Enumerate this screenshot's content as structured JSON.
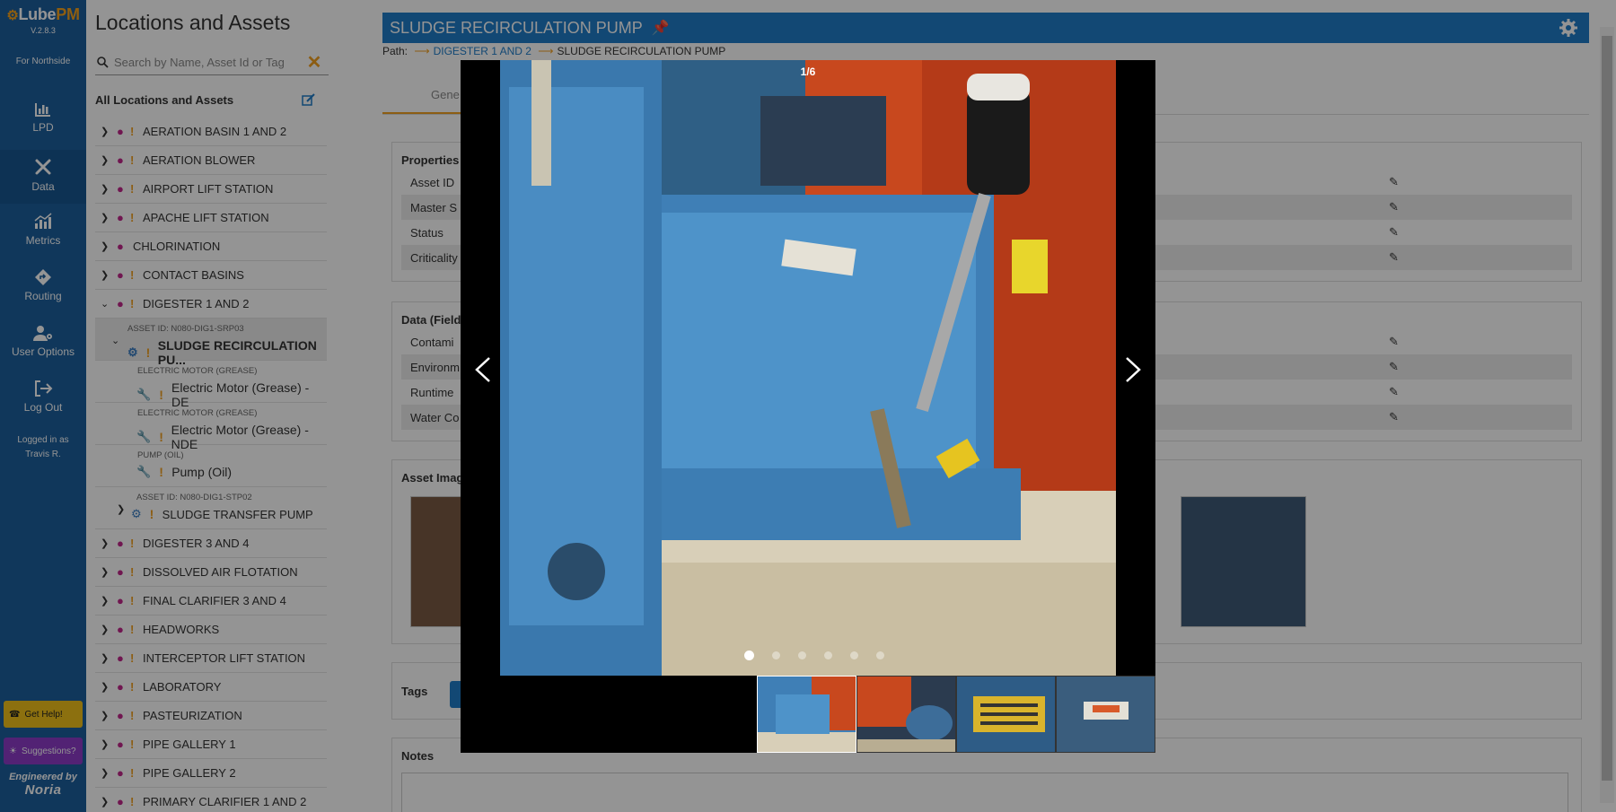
{
  "app": {
    "logo_prefix": "Lube",
    "logo_suffix": "PM",
    "version": "V.2.8.3",
    "org": "For Northside"
  },
  "nav": [
    {
      "label": "LPD",
      "icon": "bar-chart-icon"
    },
    {
      "label": "Data",
      "icon": "tools-icon"
    },
    {
      "label": "Metrics",
      "icon": "metrics-icon"
    },
    {
      "label": "Routing",
      "icon": "routing-icon"
    },
    {
      "label": "User Options",
      "icon": "user-gear-icon"
    },
    {
      "label": "Log Out",
      "icon": "logout-icon"
    }
  ],
  "user": {
    "logged_in_label": "Logged in as",
    "name": "Travis R."
  },
  "help": {
    "get_help": "Get Help!",
    "suggestions": "Suggestions?",
    "engineered_by": "Engineered by",
    "brand": "Noria"
  },
  "tree": {
    "title": "Locations and Assets",
    "search_placeholder": "Search by Name, Asset Id or Tag",
    "all_label": "All Locations and Assets",
    "rows_top": [
      {
        "label": "AERATION BASIN 1 AND 2",
        "flag": true
      },
      {
        "label": "AERATION BLOWER",
        "flag": true
      },
      {
        "label": "AIRPORT LIFT STATION",
        "flag": true
      },
      {
        "label": "APACHE LIFT STATION",
        "flag": true
      },
      {
        "label": "CHLORINATION",
        "flag": false
      },
      {
        "label": "CONTACT BASINS",
        "flag": true
      },
      {
        "label": "DIGESTER 1 AND 2",
        "flag": true
      }
    ],
    "children": [
      {
        "caption": "ASSET ID: N080-DIG1-SRP03",
        "label": "SLUDGE RECIRCULATION PU...",
        "kind": "asset",
        "selected": true
      },
      {
        "caption": "ELECTRIC MOTOR (GREASE)",
        "label": "Electric Motor (Grease) - DE",
        "kind": "component"
      },
      {
        "caption": "ELECTRIC MOTOR (GREASE)",
        "label": "Electric Motor (Grease) - NDE",
        "kind": "component"
      },
      {
        "caption": "PUMP (OIL)",
        "label": "Pump (Oil)",
        "kind": "component"
      },
      {
        "caption": "ASSET ID: N080-DIG1-STP02",
        "label": "SLUDGE TRANSFER PUMP",
        "kind": "asset2"
      }
    ],
    "rows_bottom": [
      {
        "label": "DIGESTER 3 AND 4"
      },
      {
        "label": "DISSOLVED AIR FLOTATION"
      },
      {
        "label": "FINAL CLARIFIER 3 AND 4"
      },
      {
        "label": "HEADWORKS"
      },
      {
        "label": "INTERCEPTOR LIFT STATION"
      },
      {
        "label": "LABORATORY"
      },
      {
        "label": "PASTEURIZATION"
      },
      {
        "label": "PIPE GALLERY 1"
      },
      {
        "label": "PIPE GALLERY 2"
      },
      {
        "label": "PRIMARY CLARIFIER 1 AND 2"
      }
    ]
  },
  "main": {
    "title": "SLUDGE RECIRCULATION PUMP",
    "path_label": "Path:",
    "path_parent": "DIGESTER 1 AND 2",
    "path_current": "SLUDGE RECIRCULATION PUMP",
    "tab": "Gene",
    "properties": {
      "title": "Properties",
      "rows": [
        "Asset ID",
        "Master S",
        "Status",
        "Criticality"
      ]
    },
    "data": {
      "title": "Data (Fields",
      "rows": [
        "Contami",
        "Environm",
        "Runtime",
        "Water Co"
      ]
    },
    "images_title": "Asset Imag",
    "tags_title": "Tags",
    "notes_title": "Notes"
  },
  "lightbox": {
    "counter": "1/6",
    "total": 6,
    "current": 1
  }
}
